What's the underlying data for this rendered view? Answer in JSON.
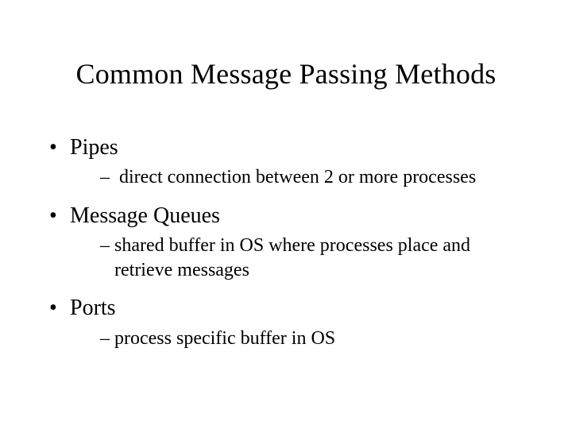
{
  "title": "Common Message Passing Methods",
  "items": [
    {
      "label": "Pipes",
      "sub": "direct connection between 2 or more processes"
    },
    {
      "label": "Message Queues",
      "sub": "shared buffer in OS where processes place and retrieve messages"
    },
    {
      "label": "Ports",
      "sub": "process specific buffer in OS"
    }
  ]
}
